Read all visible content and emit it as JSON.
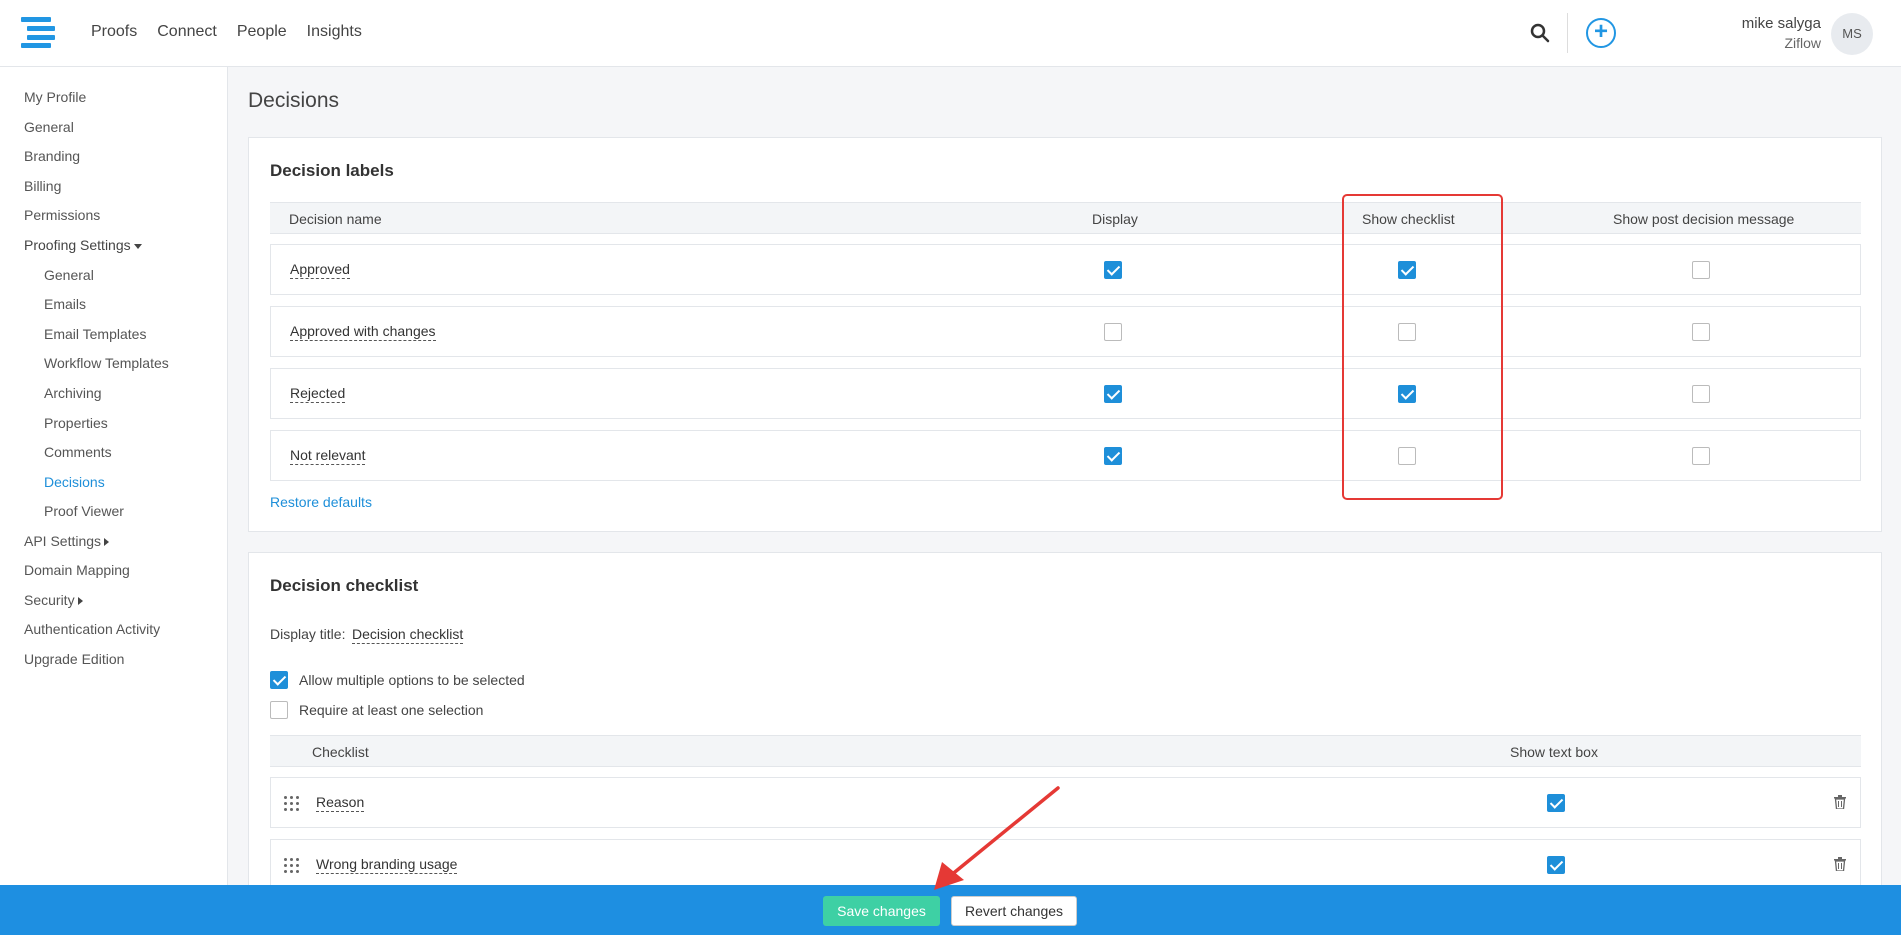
{
  "nav": {
    "items": [
      "Proofs",
      "Connect",
      "People",
      "Insights"
    ]
  },
  "user": {
    "name": "mike salyga",
    "org": "Ziflow",
    "initials": "MS"
  },
  "sidebar": {
    "my_profile": "My Profile",
    "general": "General",
    "branding": "Branding",
    "billing": "Billing",
    "permissions": "Permissions",
    "proofing_settings": "Proofing Settings",
    "sub": {
      "general": "General",
      "emails": "Emails",
      "email_templates": "Email Templates",
      "workflow_templates": "Workflow Templates",
      "archiving": "Archiving",
      "properties": "Properties",
      "comments": "Comments",
      "decisions": "Decisions",
      "proof_viewer": "Proof Viewer"
    },
    "api_settings": "API Settings",
    "domain_mapping": "Domain Mapping",
    "security": "Security",
    "authentication_activity": "Authentication Activity",
    "upgrade_edition": "Upgrade Edition"
  },
  "page": {
    "title": "Decisions"
  },
  "labels_card": {
    "title": "Decision labels",
    "headers": [
      "Decision name",
      "Display",
      "Show checklist",
      "Show post decision message"
    ],
    "rows": [
      {
        "name": "Approved",
        "display": true,
        "checklist": true,
        "post": false
      },
      {
        "name": "Approved with changes",
        "display": false,
        "checklist": false,
        "post": false
      },
      {
        "name": "Rejected",
        "display": true,
        "checklist": true,
        "post": false
      },
      {
        "name": "Not relevant",
        "display": true,
        "checklist": false,
        "post": false
      }
    ],
    "restore": "Restore defaults"
  },
  "checklist_card": {
    "title": "Decision checklist",
    "display_title_label": "Display title:",
    "display_title_value": "Decision checklist",
    "allow_multiple": {
      "label": "Allow multiple options to be selected",
      "checked": true
    },
    "require_one": {
      "label": "Require at least one selection",
      "checked": false
    },
    "headers": [
      "Checklist",
      "Show text box"
    ],
    "rows": [
      {
        "name": "Reason",
        "text_box": true
      },
      {
        "name": "Wrong branding usage",
        "text_box": true
      }
    ]
  },
  "footer": {
    "save": "Save changes",
    "revert": "Revert changes"
  },
  "colors": {
    "accent": "#1e8fd9",
    "footer": "#1e8fe1",
    "save": "#3ed0a4",
    "highlight": "#e53935"
  }
}
